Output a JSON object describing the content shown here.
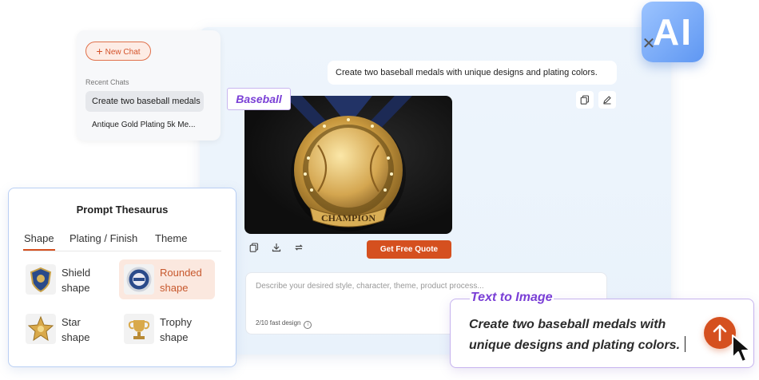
{
  "sidebar": {
    "new_chat_label": "New Chat",
    "recent_title": "Recent Chats",
    "chats": [
      "Create two baseball medals",
      "Antique Gold Plating 5k Me..."
    ]
  },
  "conversation": {
    "user_message": "Create two baseball medals with unique designs and plating colors.",
    "image_tag": "Baseball",
    "medal_text": "CHAMPION",
    "quote_button": "Get Free Quote"
  },
  "input": {
    "placeholder": "Describe your desired style, character, theme, product process...",
    "quota": "2/10 fast design"
  },
  "badge": {
    "label": "AI"
  },
  "thesaurus": {
    "title": "Prompt Thesaurus",
    "tabs": [
      "Shape",
      "Plating / Finish",
      "Theme"
    ],
    "options": [
      {
        "label_line1": "Shield",
        "label_line2": "shape"
      },
      {
        "label_line1": "Rounded",
        "label_line2": "shape"
      },
      {
        "label_line1": "Star",
        "label_line2": "shape"
      },
      {
        "label_line1": "Trophy",
        "label_line2": "shape"
      }
    ]
  },
  "callout": {
    "title": "Text to Image",
    "text": "Create two baseball medals with unique designs and plating colors."
  },
  "colors": {
    "accent": "#d5501f",
    "purple": "#7a3fd6",
    "ai_badge": "#6a9ff5"
  },
  "icons": {
    "close": "close-icon",
    "copy": "copy-icon",
    "edit": "edit-icon",
    "download": "download-icon",
    "regenerate": "regenerate-icon",
    "send": "arrow-up-icon",
    "cursor": "cursor-pointer-icon"
  }
}
